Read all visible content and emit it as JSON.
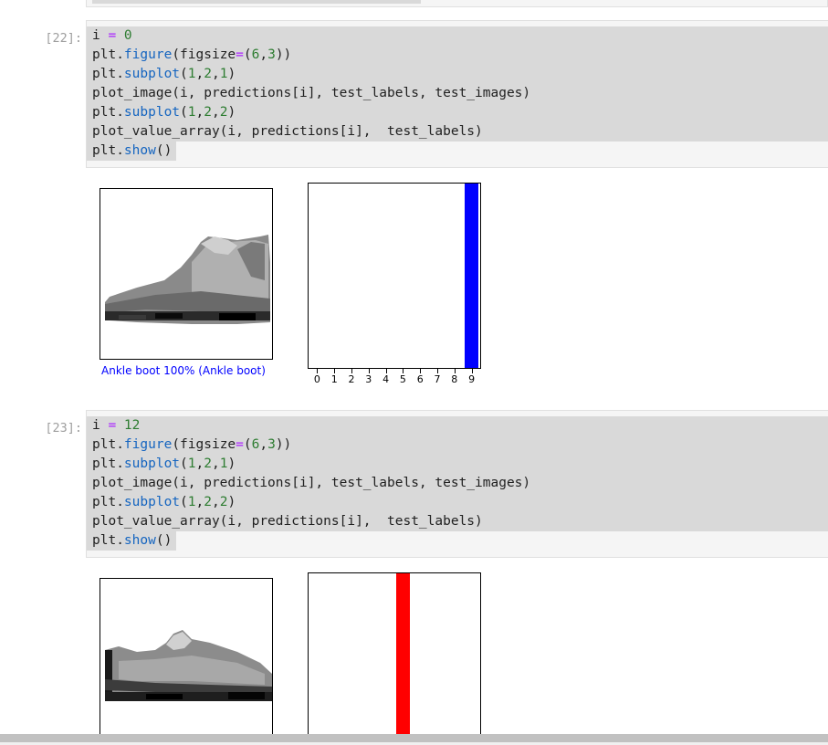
{
  "cells": [
    {
      "prompt": "[22]:",
      "code": {
        "line1": {
          "a": "i ",
          "op": "=",
          "num": " 0"
        },
        "line2": {
          "a": "plt.",
          "fn": "figure",
          "b": "(figsize",
          "op": "=",
          "c": "(",
          "n1": "6",
          "d": ",",
          "n2": "3",
          "e": "))"
        },
        "line3": {
          "a": "plt.",
          "fn": "subplot",
          "b": "(",
          "n1": "1",
          "c": ",",
          "n2": "2",
          "d": ",",
          "n3": "1",
          "e": ")"
        },
        "line4": "plot_image(i, predictions[i], test_labels, test_images)",
        "line5": {
          "a": "plt.",
          "fn": "subplot",
          "b": "(",
          "n1": "1",
          "c": ",",
          "n2": "2",
          "d": ",",
          "n3": "2",
          "e": ")"
        },
        "line6": "plot_value_array(i, predictions[i],  test_labels)",
        "line7": {
          "a": "plt.",
          "fn": "show",
          "b": "()"
        }
      },
      "output": {
        "caption": "Ankle boot 100% (Ankle boot)",
        "caption_color": "#0000ff",
        "bar_color": "#0000ff",
        "bar_class": 9,
        "bar_value": 1.0,
        "tick_labels": [
          "0",
          "1",
          "2",
          "3",
          "4",
          "5",
          "6",
          "7",
          "8",
          "9"
        ]
      }
    },
    {
      "prompt": "[23]:",
      "code": {
        "line1": {
          "a": "i ",
          "op": "=",
          "num": " 12"
        },
        "line2": {
          "a": "plt.",
          "fn": "figure",
          "b": "(figsize",
          "op": "=",
          "c": "(",
          "n1": "6",
          "d": ",",
          "n2": "3",
          "e": "))"
        },
        "line3": {
          "a": "plt.",
          "fn": "subplot",
          "b": "(",
          "n1": "1",
          "c": ",",
          "n2": "2",
          "d": ",",
          "n3": "1",
          "e": ")"
        },
        "line4": "plot_image(i, predictions[i], test_labels, test_images)",
        "line5": {
          "a": "plt.",
          "fn": "subplot",
          "b": "(",
          "n1": "1",
          "c": ",",
          "n2": "2",
          "d": ",",
          "n3": "2",
          "e": ")"
        },
        "line6": "plot_value_array(i, predictions[i],  test_labels)",
        "line7": {
          "a": "plt.",
          "fn": "show",
          "b": "()"
        }
      },
      "output": {
        "bar_color": "#ff0000",
        "bar_class": 5,
        "bar_value": 1.0
      }
    }
  ],
  "colors": {
    "accent_blue": "#0000ff",
    "accent_red": "#ff0000",
    "keyword": "#1565c0",
    "number": "#2e7d32",
    "operator": "#aa22ff"
  }
}
